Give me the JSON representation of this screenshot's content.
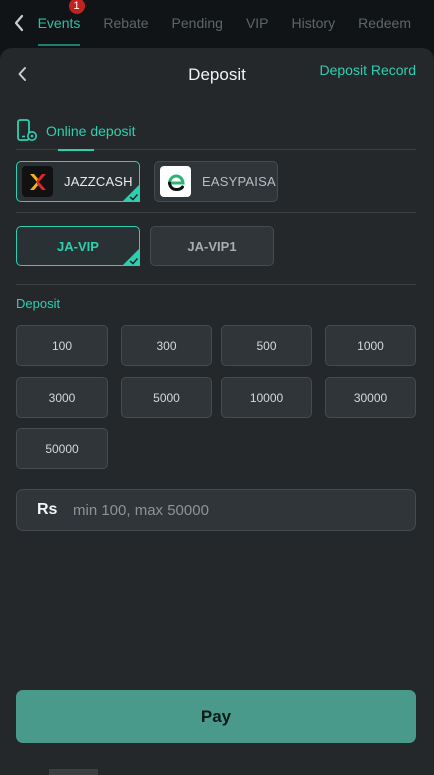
{
  "topbar": {
    "tabs": [
      {
        "label": "Events",
        "active": true,
        "badge": "1"
      },
      {
        "label": "Rebate"
      },
      {
        "label": "Pending"
      },
      {
        "label": "VIP"
      },
      {
        "label": "History"
      },
      {
        "label": "Redeem"
      }
    ]
  },
  "header": {
    "title": "Deposit",
    "record_link": "Deposit Record"
  },
  "method_tab": {
    "label": "Online deposit",
    "icon": "phone-icon"
  },
  "providers": [
    {
      "name": "JAZZCASH",
      "selected": true,
      "icon": "jazzcash-logo"
    },
    {
      "name": "EASYPAISA",
      "selected": false,
      "icon": "easypaisa-logo"
    }
  ],
  "channels": [
    {
      "name": "JA-VIP",
      "selected": true
    },
    {
      "name": "JA-VIP1",
      "selected": false
    }
  ],
  "deposit": {
    "label": "Deposit",
    "amounts": [
      "100",
      "300",
      "500",
      "1000",
      "3000",
      "5000",
      "10000",
      "30000",
      "50000"
    ],
    "currency": "Rs",
    "placeholder": "min 100, max 50000"
  },
  "pay_button": "Pay",
  "colors": {
    "accent": "#2cd0b0",
    "pay": "#4a9a8c",
    "sheet": "#24282b",
    "badge": "#c0221f"
  }
}
